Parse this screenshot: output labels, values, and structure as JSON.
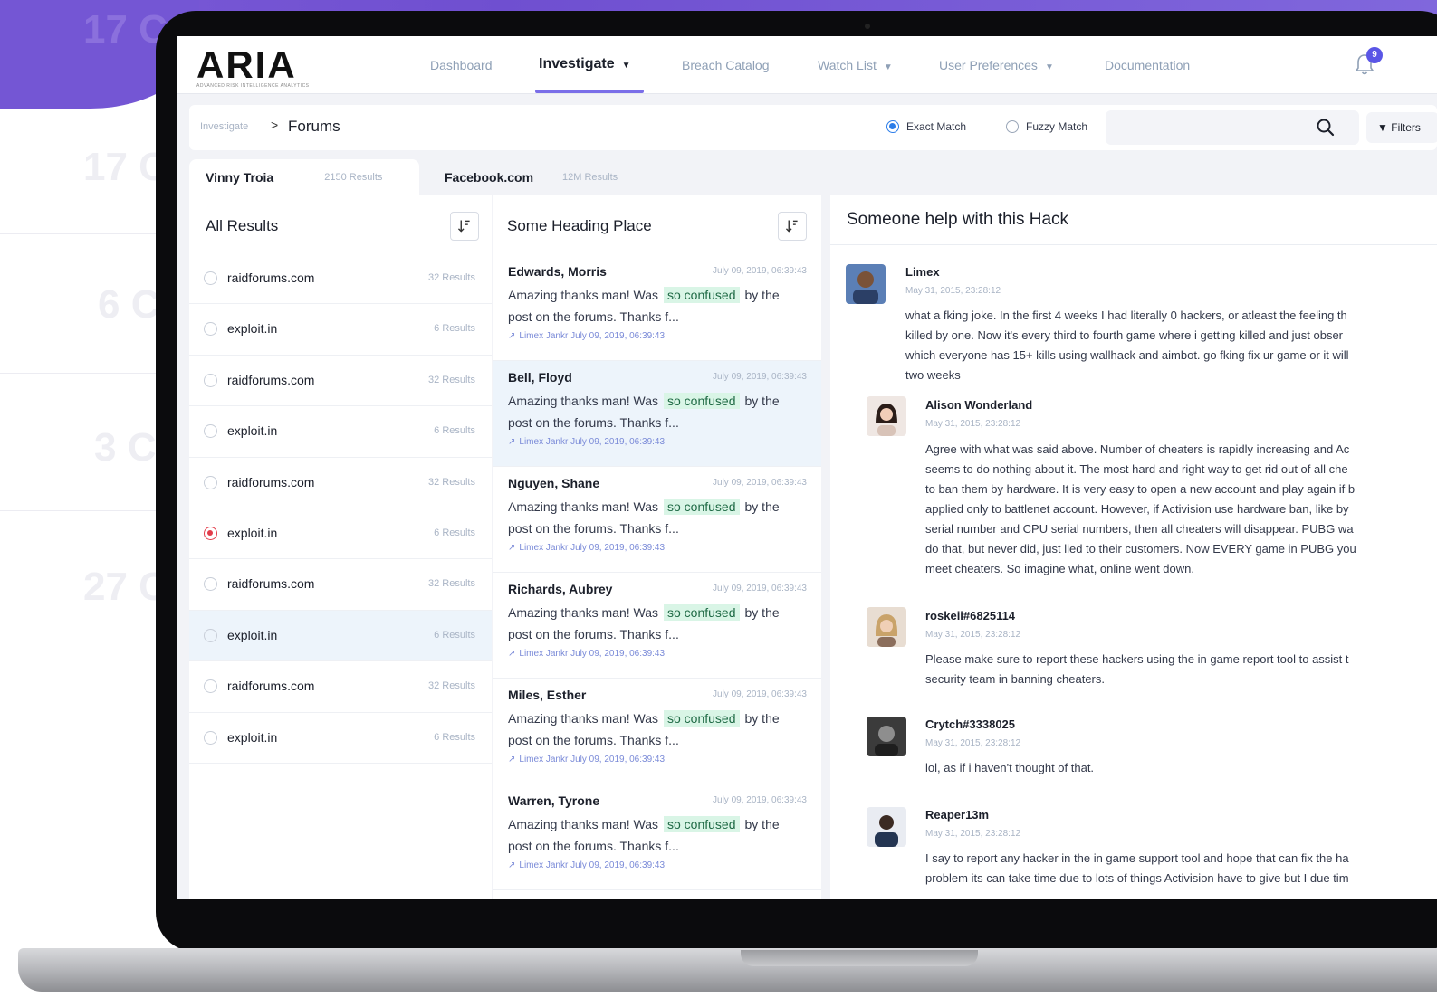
{
  "backdrop": {
    "ghost_labels": [
      "17 C",
      "17 C",
      "6 C",
      "3 C",
      "27 C"
    ]
  },
  "app": {
    "logo": "ARIA",
    "logo_sub": "ADVANCED RISK INTELLIGENCE ANALYTICS"
  },
  "nav": {
    "items": [
      {
        "label": "Dashboard"
      },
      {
        "label": "Investigate",
        "active": true
      },
      {
        "label": "Breach Catalog"
      },
      {
        "label": "Watch List"
      },
      {
        "label": "User Preferences"
      },
      {
        "label": "Documentation"
      }
    ],
    "notifications": "9"
  },
  "breadcrumb": {
    "root": "Investigate",
    "separator": ">",
    "current": "Forums"
  },
  "search": {
    "exact_label": "Exact Match",
    "fuzzy_label": "Fuzzy Match",
    "placeholder": "",
    "filters_label": "Filters"
  },
  "tabs": [
    {
      "label": "Vinny Troia",
      "count": "2150 Results"
    },
    {
      "label": "Facebook.com",
      "count": "12M Results"
    }
  ],
  "results": {
    "heading": "All Results",
    "items": [
      {
        "name": "raidforums.com",
        "count": "32 Results"
      },
      {
        "name": "exploit.in",
        "count": "6 Results"
      },
      {
        "name": "raidforums.com",
        "count": "32 Results"
      },
      {
        "name": "exploit.in",
        "count": "6 Results"
      },
      {
        "name": "raidforums.com",
        "count": "32 Results"
      },
      {
        "name": "exploit.in",
        "count": "6 Results"
      },
      {
        "name": "raidforums.com",
        "count": "32 Results"
      },
      {
        "name": "exploit.in",
        "count": "6 Results"
      },
      {
        "name": "raidforums.com",
        "count": "32 Results"
      },
      {
        "name": "exploit.in",
        "count": "6 Results"
      }
    ]
  },
  "messages": {
    "heading": "Some Heading Place",
    "snippet_before": "Amazing thanks man! Was",
    "snippet_highlight": "so confused",
    "snippet_after": "by the",
    "snippet_line2": "post on the forums. Thanks f...",
    "items": [
      {
        "name": "Edwards, Morris",
        "date": "July 09, 2019, 06:39:43",
        "meta": "Limex Jankr July 09, 2019, 06:39:43"
      },
      {
        "name": "Bell, Floyd",
        "date": "July 09, 2019, 06:39:43",
        "meta": "Limex Jankr July 09, 2019, 06:39:43"
      },
      {
        "name": "Nguyen, Shane",
        "date": "July 09, 2019, 06:39:43",
        "meta": "Limex Jankr July 09, 2019, 06:39:43"
      },
      {
        "name": "Richards, Aubrey",
        "date": "July 09, 2019, 06:39:43",
        "meta": "Limex Jankr July 09, 2019, 06:39:43"
      },
      {
        "name": "Miles, Esther",
        "date": "July 09, 2019, 06:39:43",
        "meta": "Limex Jankr July 09, 2019, 06:39:43"
      },
      {
        "name": "Warren, Tyrone",
        "date": "July 09, 2019, 06:39:43",
        "meta": "Limex Jankr July 09, 2019, 06:39:43"
      }
    ]
  },
  "thread": {
    "title": "Someone help with this Hack",
    "posts": [
      {
        "user": "Limex",
        "date": "May 31, 2015, 23:28:12",
        "lines": [
          "what a fking joke. In the first 4 weeks I had literally 0 hackers, or atleast the feeling th",
          "killed by one. Now it's every third to fourth game where i getting killed and just obser",
          "which everyone has 15+ kills using wallhack and aimbot. go fking fix ur game or it will",
          "two weeks"
        ]
      },
      {
        "user": "Alison Wonderland",
        "date": "May 31, 2015, 23:28:12",
        "lines": [
          "Agree with what was said above. Number of cheaters is rapidly increasing and Ac",
          "seems to do nothing about it. The most hard and right way to get rid out of all che",
          "to ban them by hardware. It is very easy to open a new account and play again if b",
          "applied only to battlenet account. However, if Activision use hardware ban, like by",
          "serial number and CPU serial numbers, then all cheaters will disappear. PUBG wa",
          "do that, but never did, just lied to their customers. Now EVERY game in PUBG you",
          "meet cheaters. So imagine what, online went down."
        ]
      },
      {
        "user": "roskeii#6825114",
        "date": "May 31, 2015, 23:28:12",
        "lines": [
          "Please make sure to report these hackers using the in game report tool to assist t",
          "security team in banning cheaters."
        ]
      },
      {
        "user": "Crytch#3338025",
        "date": "May 31, 2015, 23:28:12",
        "lines": [
          "lol, as if i haven't thought of that."
        ]
      },
      {
        "user": "Reaper13m",
        "date": "May 31, 2015, 23:28:12",
        "lines": [
          "I say to report any hacker in the in game support tool and hope that can fix the ha",
          "problem its can take time due to lots of things Activision have to give but I due tim"
        ]
      }
    ]
  },
  "colors": {
    "accent": "#7a6ee8",
    "brand_purple": "#7456d4",
    "highlight": "#d9f5e6",
    "selected_row": "#edf4fb",
    "alert": "#e23c4a",
    "radio_on": "#2b7de9"
  }
}
